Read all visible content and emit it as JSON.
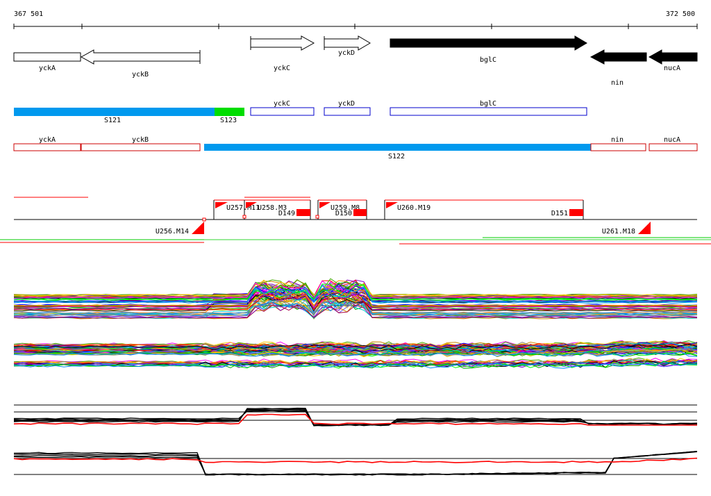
{
  "ruler": {
    "start_label": "367 501",
    "end_label": "372 500"
  },
  "colors": {
    "segment_blue": "#0099ee",
    "segment_green": "#00dd00",
    "outline_blue": "#0000cc",
    "outline_red": "#cc0000",
    "marker_red": "#ff0000",
    "trace_green": "#00cc00",
    "black": "#000000"
  },
  "genes": [
    {
      "label": "yckA",
      "strand": "none"
    },
    {
      "label": "yckB",
      "strand": "reverse"
    },
    {
      "label": "yckC",
      "strand": "forward"
    },
    {
      "label": "yckD",
      "strand": "forward"
    },
    {
      "label": "bglC",
      "strand": "forward",
      "filled": true
    },
    {
      "label": "nin",
      "strand": "reverse",
      "filled": true
    },
    {
      "label": "nucA",
      "strand": "reverse",
      "filled": true
    }
  ],
  "blue_track": {
    "segments": [
      {
        "label": "S121",
        "color": "blue"
      },
      {
        "label": "S123",
        "color": "green"
      }
    ],
    "boxes": [
      "yckC",
      "yckD",
      "bglC"
    ]
  },
  "red_track": {
    "boxes": [
      "yckA",
      "yckB",
      "nin",
      "nucA"
    ],
    "segment": {
      "label": "S122",
      "color": "blue"
    }
  },
  "features": {
    "upper": [
      "U257.M11",
      "U258.M3",
      "U259.M8",
      "U260.M19"
    ],
    "deletions": [
      "D149",
      "D150",
      "D151"
    ],
    "lower": [
      "U256.M14",
      "U261.M18"
    ]
  }
}
